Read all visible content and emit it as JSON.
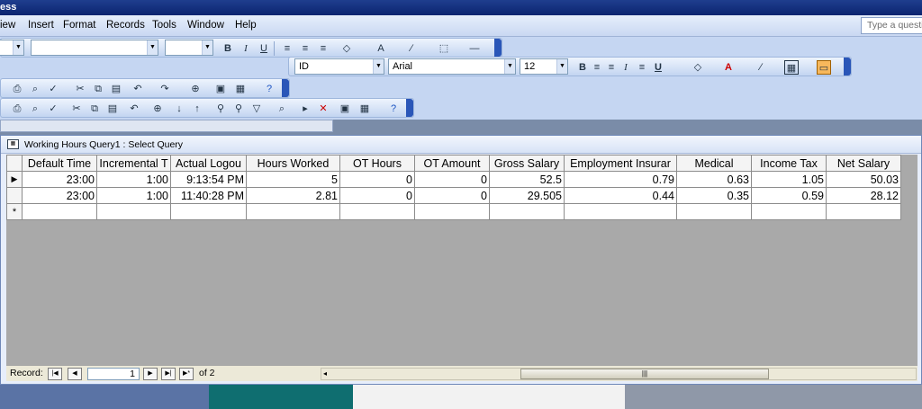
{
  "title": "ess",
  "menu": [
    "iew",
    "Insert",
    "Format",
    "Records",
    "Tools",
    "Window",
    "Help"
  ],
  "help_placeholder": "Type a questi",
  "format_bar": {
    "field": "ID",
    "font": "Arial",
    "size": "12"
  },
  "query_window": {
    "title": "Working Hours Query1 : Select Query",
    "columns": [
      "Default Time",
      "Incremental T",
      "Actual Logou",
      "Hours Worked",
      "OT Hours",
      "OT Amount",
      "Gross Salary",
      "Employment Insurar",
      "Medical",
      "Income Tax",
      "Net Salary"
    ],
    "rows": [
      [
        "23:00",
        "1:00",
        "9:13:54 PM",
        "5",
        "0",
        "0",
        "52.5",
        "0.79",
        "0.63",
        "1.05",
        "50.03"
      ],
      [
        "23:00",
        "1:00",
        "11:40:28 PM",
        "2.81",
        "0",
        "0",
        "29.505",
        "0.44",
        "0.35",
        "0.59",
        "28.12"
      ]
    ],
    "new_row_marker": "*",
    "current_row_marker": "▶"
  },
  "navigation": {
    "label": "Record:",
    "current": "1",
    "of_text": "of 2"
  },
  "icons": [
    "bold-icon",
    "italic-icon",
    "underline-icon",
    "align-left-icon",
    "align-center-icon",
    "align-right-icon",
    "fill-color-icon",
    "font-color-icon",
    "line-color-icon",
    "help-icon",
    "print-icon",
    "cut-icon",
    "copy-icon",
    "paste-icon",
    "undo-icon",
    "sort-ascending-icon",
    "sort-descending-icon",
    "filter-icon",
    "find-icon",
    "new-record-icon",
    "delete-record-icon"
  ]
}
